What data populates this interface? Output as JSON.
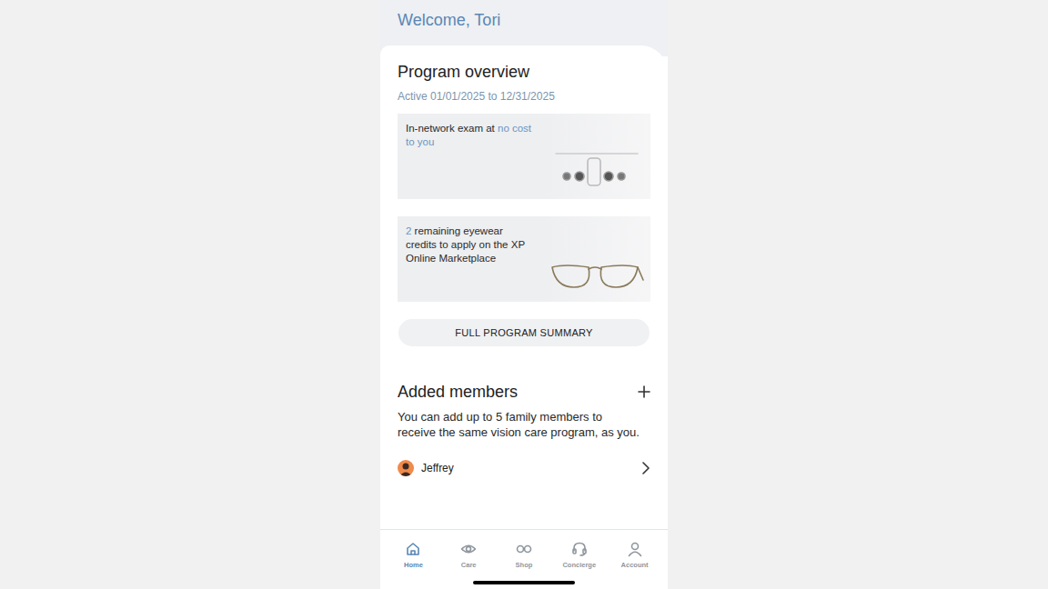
{
  "header": {
    "welcome": "Welcome, Tori"
  },
  "overview": {
    "title": "Program overview",
    "active": "Active 01/01/2025 to 12/31/2025",
    "cards": [
      {
        "kind": "exam",
        "segments": [
          {
            "text": "In-network exam at ",
            "highlight": false
          },
          {
            "text": "no cost to you",
            "highlight": true
          }
        ]
      },
      {
        "kind": "eyewear",
        "segments": [
          {
            "text": "2",
            "highlight": true
          },
          {
            "text": " remaining eyewear credits to apply on the XP Online Marketplace",
            "highlight": false
          }
        ]
      }
    ],
    "button": "FULL PROGRAM SUMMARY"
  },
  "members": {
    "title": "Added members",
    "description": "You can add up to 5 family members to receive the same vision care program, as you.",
    "items": [
      {
        "name": "Jeffrey"
      }
    ]
  },
  "nav": [
    {
      "label": "Home",
      "selected": true
    },
    {
      "label": "Care",
      "selected": false
    },
    {
      "label": "Shop",
      "selected": false
    },
    {
      "label": "Concierge",
      "selected": false
    },
    {
      "label": "Account",
      "selected": false
    }
  ]
}
